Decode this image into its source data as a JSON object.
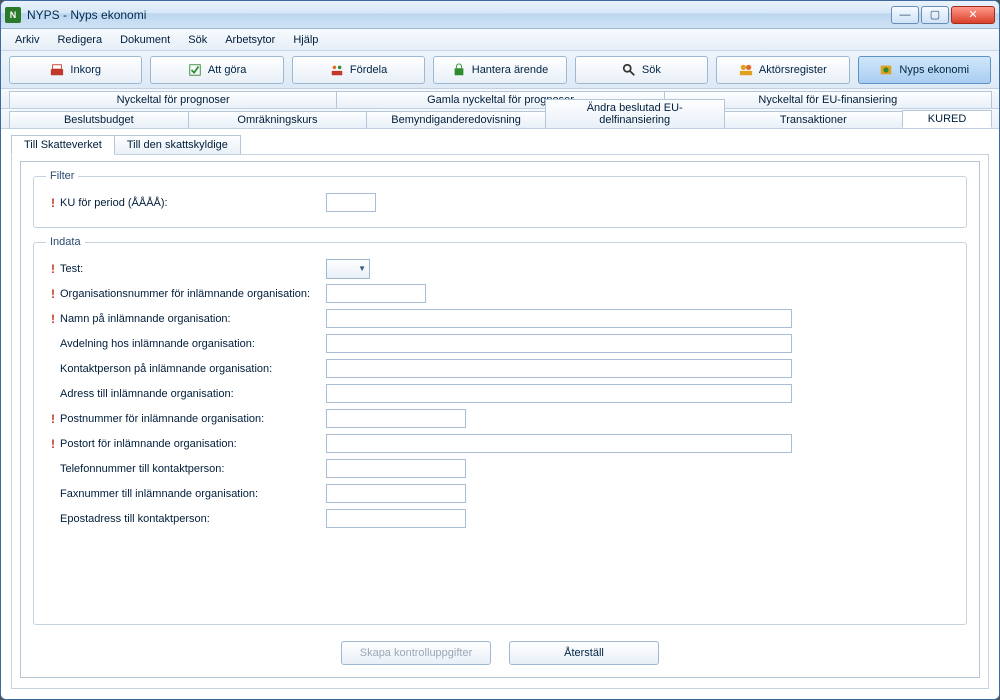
{
  "window": {
    "title": "NYPS - Nyps ekonomi"
  },
  "menu": {
    "arkiv": "Arkiv",
    "redigera": "Redigera",
    "dokument": "Dokument",
    "sok": "Sök",
    "arbetsytor": "Arbetsytor",
    "hjalp": "Hjälp"
  },
  "toolbar": {
    "inkorg": "Inkorg",
    "attgora": "Att göra",
    "fordela": "Fördela",
    "hantera": "Hantera ärende",
    "sok": "Sök",
    "aktors": "Aktörsregister",
    "ekonomi": "Nyps ekonomi"
  },
  "tabs1": {
    "a": "Nyckeltal för prognoser",
    "b": "Gamla nyckeltal för prognoser",
    "c": "Nyckeltal för EU-finansiering"
  },
  "tabs2": {
    "a": "Beslutsbudget",
    "b": "Omräkningskurs",
    "c": "Bemyndiganderedovisning",
    "d": "Ändra beslutad EU-delfinansiering",
    "e": "Transaktioner",
    "f": "KURED"
  },
  "subtabs": {
    "a": "Till Skatteverket",
    "b": "Till den skattskyldige"
  },
  "filter": {
    "legend": "Filter",
    "period_label": "KU för period (ÅÅÅÅ):"
  },
  "indata": {
    "legend": "Indata",
    "test": "Test:",
    "orgnr": "Organisationsnummer för inlämnande organisation:",
    "namn": "Namn på inlämnande organisation:",
    "avdelning": "Avdelning hos inlämnande organisation:",
    "kontakt": "Kontaktperson på inlämnande organisation:",
    "adress": "Adress till inlämnande organisation:",
    "postnr": "Postnummer för inlämnande organisation:",
    "postort": "Postort för inlämnande organisation:",
    "telefon": "Telefonnummer till kontaktperson:",
    "fax": "Faxnummer till inlämnande organisation:",
    "epost": "Epostadress till kontaktperson:"
  },
  "buttons": {
    "skapa": "Skapa kontrolluppgifter",
    "aterstall": "Återställ"
  }
}
